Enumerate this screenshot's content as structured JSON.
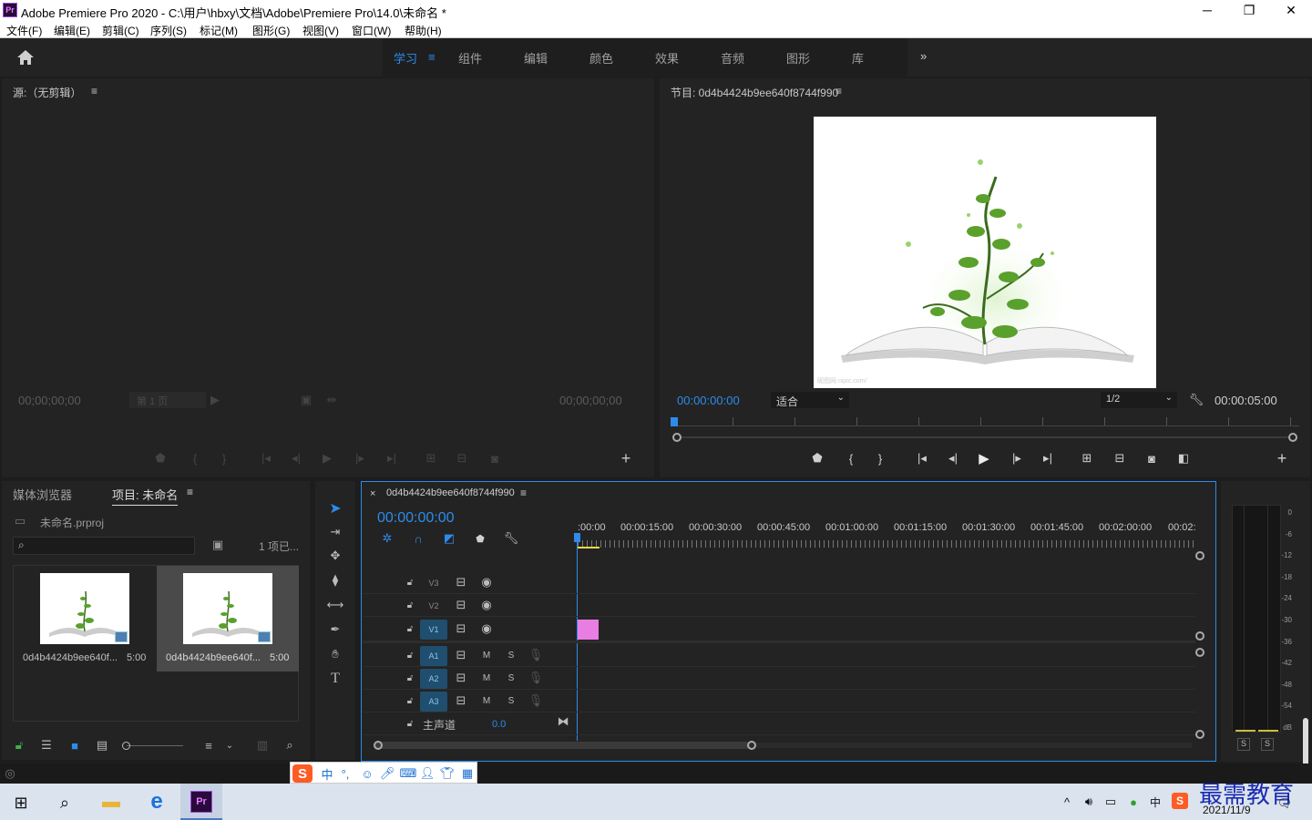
{
  "window": {
    "app_icon": "Pr",
    "title": "Adobe Premiere Pro 2020 - C:\\用户\\hbxy\\文档\\Adobe\\Premiere Pro\\14.0\\未命名 *"
  },
  "menu": [
    "文件(F)",
    "编辑(E)",
    "剪辑(C)",
    "序列(S)",
    "标记(M)",
    "图形(G)",
    "视图(V)",
    "窗口(W)",
    "帮助(H)"
  ],
  "workspaces": [
    "学习",
    "组件",
    "编辑",
    "颜色",
    "效果",
    "音频",
    "图形",
    "库"
  ],
  "source": {
    "title": "源:（无剪辑）",
    "tc_left": "00;00;00;00",
    "page": "第 1 页",
    "tc_right": "00;00;00;00"
  },
  "program": {
    "title": "节目: 0d4b4424b9ee640f8744f990",
    "tc_current": "00:00:00:00",
    "fit": "适合",
    "res": "1/2",
    "tc_duration": "00:00:05:00",
    "watermark": "昵图网 nipic.com/"
  },
  "project": {
    "tab_media": "媒体浏览器",
    "tab_project": "项目: 未命名",
    "file": "未命名.prproj",
    "count": "1 项已...",
    "items": [
      {
        "name": "0d4b4424b9ee640f...",
        "dur": "5:00"
      },
      {
        "name": "0d4b4424b9ee640f...",
        "dur": "5:00"
      }
    ]
  },
  "timeline": {
    "close": "×",
    "title": "0d4b4424b9ee640f8744f990",
    "tc": "00:00:00:00",
    "ruler": [
      ":00:00",
      "00:00:15:00",
      "00:00:30:00",
      "00:00:45:00",
      "00:01:00:00",
      "00:01:15:00",
      "00:01:30:00",
      "00:01:45:00",
      "00:02:00:00",
      "00:02:"
    ],
    "video_tracks": [
      "V3",
      "V2",
      "V1"
    ],
    "audio_tracks": [
      "A1",
      "A2",
      "A3"
    ],
    "mute": "M",
    "solo": "S",
    "master": "主声道",
    "master_val": "0.0"
  },
  "meter": {
    "labels": [
      "0",
      "-6",
      "-12",
      "-18",
      "-24",
      "-30",
      "-36",
      "-42",
      "-48",
      "-54",
      "dB"
    ],
    "s1": "S",
    "s2": "S"
  },
  "taskbar": {
    "ime": [
      "中"
    ],
    "lang": "中",
    "date": "2021/11/9",
    "brand": "最需教育"
  },
  "colors": {
    "accent": "#2d8ceb",
    "clip": "#e87de3",
    "panel": "#232323"
  }
}
